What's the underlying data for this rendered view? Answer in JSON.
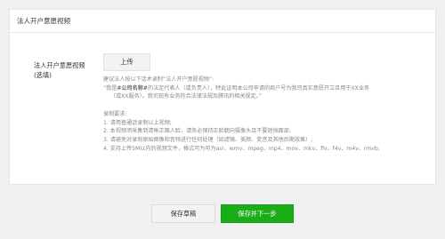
{
  "panel": {
    "title": "法人开户意愿视频"
  },
  "field": {
    "label_line1": "法人开户意愿视频",
    "label_line2": "(选填)",
    "upload_label": "上传"
  },
  "description": {
    "intro": "建议法人按以下话术录制“法人开户意愿视频”:",
    "script_prefix": "“我是",
    "script_company": "#公司名称#",
    "script_mid": "的法定代表人（或负责人），特此证明本公司申请的商户号为我司真实意愿开立且用于XX业务",
    "script_line2": "（或XX服务）。我司现有业务符合法律法规及腾讯的相关规定。”",
    "requirements_title": "录制要求:",
    "requirements": [
      "1. 请用普通话录制以上视频;",
      "2. 本视频须采集到清晰正面人脸，请务必保持正脸朝向摄像头且不要遮挡面部;",
      "3. 请避免对录制原始图像和音频进行任何处理（如滤镜、美颜、变音及其他后期效果）;",
      "4. 支持上传5M以内的视频文件，格式可为可为avi、wmv、mpeg、mp4、mov、mkv、flv、f4v、m4v、rmvb;"
    ]
  },
  "actions": {
    "save_draft": "保存草稿",
    "save_next": "保存并下一步"
  },
  "colors": {
    "accent": "#1aad19",
    "background": "#f0f0f0"
  }
}
